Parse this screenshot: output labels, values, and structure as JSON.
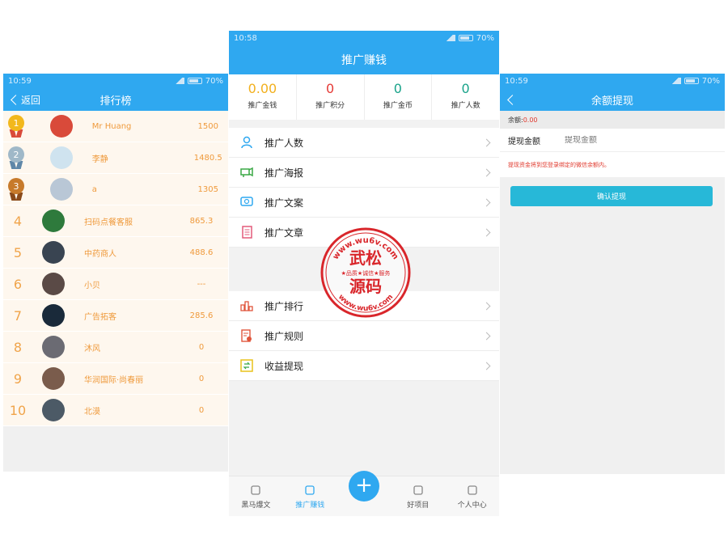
{
  "left_screen": {
    "status": {
      "time": "10:59",
      "battery": "70%"
    },
    "title": "排行榜",
    "back_label": "返回",
    "rows": [
      {
        "rank": "1",
        "name": "Mr Huang",
        "score": "1500",
        "medal": "gold",
        "avatar_color": "#d94a3a"
      },
      {
        "rank": "2",
        "name": "李静",
        "score": "1480.5",
        "medal": "silver",
        "avatar_color": "#cfe3ef"
      },
      {
        "rank": "3",
        "name": "a",
        "score": "1305",
        "medal": "bronze",
        "avatar_color": "#b9c7d6"
      },
      {
        "rank": "4",
        "name": "扫码点餐客服",
        "score": "865.3",
        "medal": "",
        "avatar_color": "#2e7a3c"
      },
      {
        "rank": "5",
        "name": "中药商人",
        "score": "488.6",
        "medal": "",
        "avatar_color": "#394451"
      },
      {
        "rank": "6",
        "name": "小贝",
        "score": "---",
        "medal": "",
        "avatar_color": "#5a4a46"
      },
      {
        "rank": "7",
        "name": "广告拓客",
        "score": "285.6",
        "medal": "",
        "avatar_color": "#1a2a3a"
      },
      {
        "rank": "8",
        "name": "沐风",
        "score": "0",
        "medal": "",
        "avatar_color": "#6b6b73"
      },
      {
        "rank": "9",
        "name": "华润国际·尚春丽",
        "score": "0",
        "medal": "",
        "avatar_color": "#7a5c4c"
      },
      {
        "rank": "10",
        "name": "北漠",
        "score": "0",
        "medal": "",
        "avatar_color": "#4c5a66"
      }
    ]
  },
  "middle_screen": {
    "status": {
      "time": "10:58",
      "battery": "70%"
    },
    "title": "推广赚钱",
    "stats": [
      {
        "value": "0.00",
        "label": "推广金钱",
        "color": "#f2b01e"
      },
      {
        "value": "0",
        "label": "推广积分",
        "color": "#e53935"
      },
      {
        "value": "0",
        "label": "推广金币",
        "color": "#19a38a"
      },
      {
        "value": "0",
        "label": "推广人数",
        "color": "#19a38a"
      }
    ],
    "menu_group_1": [
      {
        "label": "推广人数",
        "icon": "person-icon",
        "color": "#2fa8f0"
      },
      {
        "label": "推广海报",
        "icon": "megaphone-icon",
        "color": "#3aa845"
      },
      {
        "label": "推广文案",
        "icon": "chat-icon",
        "color": "#2fa8f0"
      },
      {
        "label": "推广文章",
        "icon": "document-icon",
        "color": "#e35a7a"
      }
    ],
    "menu_group_2": [
      {
        "label": "推广排行",
        "icon": "ranking-icon",
        "color": "#e0553b"
      },
      {
        "label": "推广规则",
        "icon": "rules-icon",
        "color": "#e0553b"
      },
      {
        "label": "收益提现",
        "icon": "withdraw-icon",
        "color": "#e8c21a"
      }
    ],
    "tabs": [
      {
        "label": "黑马爆文",
        "icon": "clipboard-icon",
        "active": false
      },
      {
        "label": "推广赚钱",
        "icon": "moneybag-icon",
        "active": true
      },
      {
        "label": "+",
        "icon": "plus-icon",
        "active": false
      },
      {
        "label": "好项目",
        "icon": "folder-icon",
        "active": false
      },
      {
        "label": "个人中心",
        "icon": "user-icon",
        "active": false
      }
    ]
  },
  "right_screen": {
    "status": {
      "time": "10:59",
      "battery": "70%"
    },
    "title": "余额提现",
    "balance_label": "余额:",
    "balance_value": "0.00",
    "amount_label": "提现金额",
    "amount_placeholder": "提现金额",
    "notice": "提现资金将到您登录绑定的微信余额内。",
    "confirm_label": "确认提现"
  },
  "watermark": {
    "url_top": "www.wu6v.com",
    "name": "武松",
    "tagline": "★品质★诚信★服务",
    "sub": "源码",
    "url_bottom": "www.wu6v.com"
  },
  "colors": {
    "primary": "#2fa8f0",
    "rank_bg": "#fef7ee",
    "rank_text": "#ef9a3c",
    "alert": "#e03a2e",
    "confirm": "#27b8d8"
  }
}
